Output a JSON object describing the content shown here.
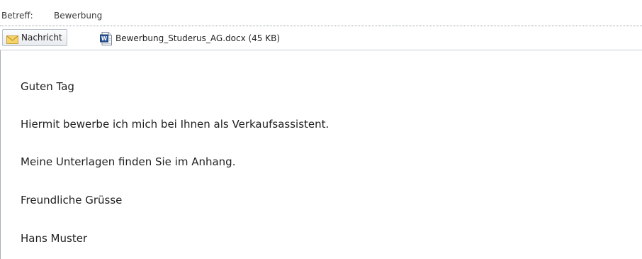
{
  "header": {
    "subject_label": "Betreff:",
    "subject_value": "Bewerbung"
  },
  "attachments_bar": {
    "message_tab": {
      "icon": "envelope-icon",
      "label": "Nachricht"
    },
    "attachment": {
      "icon": "word-document-icon",
      "label": "Bewerbung_Studerus_AG.docx (45 KB)"
    }
  },
  "body": {
    "lines": [
      "Guten Tag",
      "Hiermit bewerbe ich mich bei Ihnen als Verkaufsassistent.",
      "Meine Unterlagen finden Sie im Anhang.",
      "Freundliche Grüsse",
      "Hans Muster"
    ]
  },
  "colors": {
    "text": "#1f1f1f",
    "header_text": "#3b3b3b",
    "envelope_fill": "#f6d36b",
    "word_blue": "#2b579a"
  }
}
